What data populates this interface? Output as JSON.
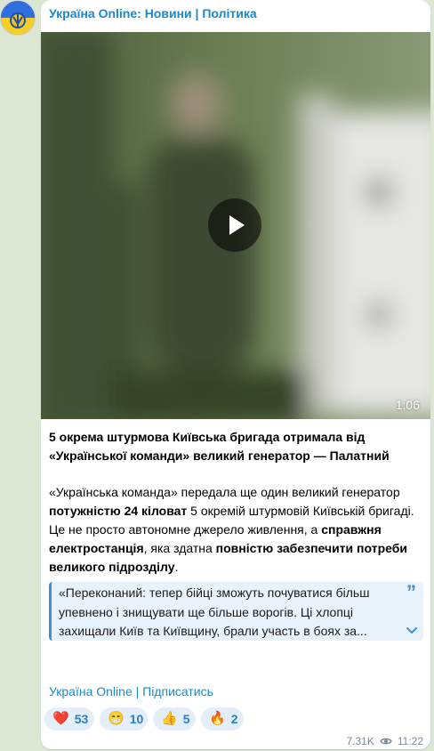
{
  "channel": {
    "name": "Україна Online: Новини | Політика",
    "avatar_icon": "ukraine-flag-avatar"
  },
  "video": {
    "duration": "1:06",
    "play_icon": "play-icon"
  },
  "post": {
    "title_lines": [
      "5 окрема штурмова Київська бригада отримала від",
      "«Української команди» великий генератор — Палатний"
    ],
    "body": {
      "l1": "«Українська команда» передала ще один великий генератор",
      "l2_bold": "потужністю 24 кіловат",
      "l2_rest": " 5 окремій штурмовій Київській бригаді.",
      "l3_a": "Це не просто автономне джерело живлення, а ",
      "l3_bold": "справжня",
      "l4_bold": "електростанція",
      "l4_rest": ", яка здатна ",
      "l4_bold2": "повністю забезпечити потреби",
      "l5_bold": "великого підрозділу",
      "l5_rest": "."
    },
    "quote_lines": [
      "«Переконаний: тепер бійці зможуть почуватися більш",
      "упевнено і знищувати ще більше ворогів. Ці хлопці",
      "захищали Київ та Київщину, брали участь в боях за..."
    ],
    "quote_mark": "”"
  },
  "footer_links": {
    "channel": "Україна Online",
    "separator": " | ",
    "subscribe": "Підписатись"
  },
  "reactions": [
    {
      "emoji": "❤️",
      "icon": "heart-icon",
      "count": "53"
    },
    {
      "emoji": "😁",
      "icon": "grin-icon",
      "count": "10"
    },
    {
      "emoji": "👍",
      "icon": "thumbs-up-icon",
      "count": "5"
    },
    {
      "emoji": "🔥",
      "icon": "fire-icon",
      "count": "2"
    }
  ],
  "meta": {
    "views": "7.31K",
    "time": "11:22"
  },
  "colors": {
    "link": "#168acd",
    "quote_accent": "#3a91d6",
    "background": "#dbe6d3"
  }
}
